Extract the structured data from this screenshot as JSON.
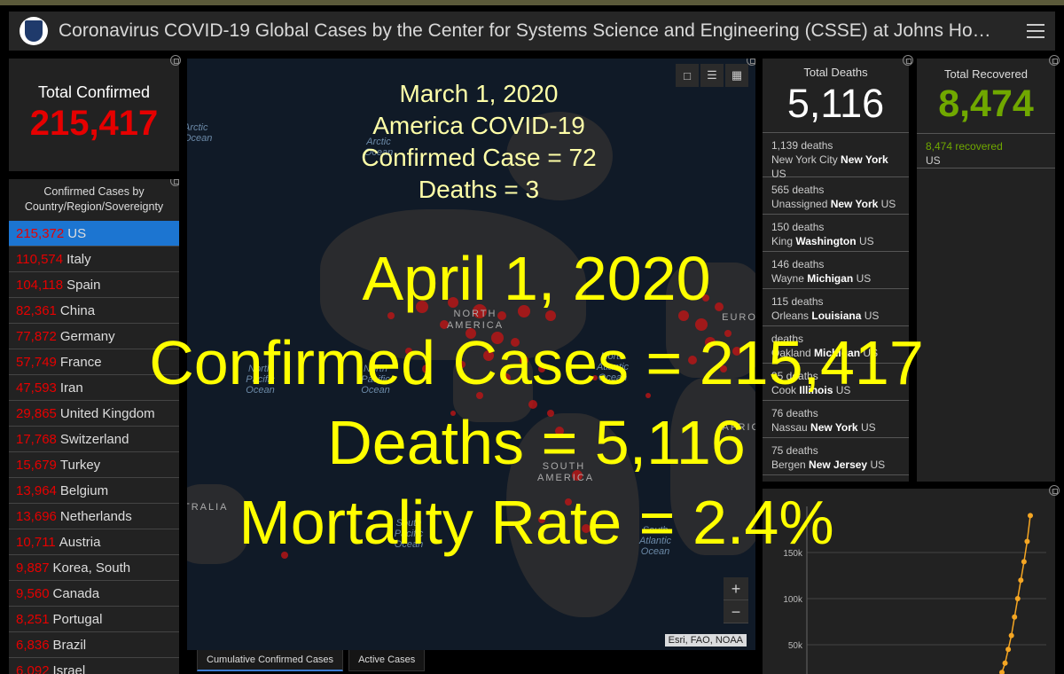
{
  "header": {
    "title": "Coronavirus COVID-19 Global Cases by the Center for Systems Science and Engineering (CSSE) at Johns Ho…"
  },
  "total_confirmed": {
    "label": "Total Confirmed",
    "value": "215,417"
  },
  "country_list": {
    "title": "Confirmed Cases by Country/Region/Sovereignty",
    "rows": [
      {
        "num": "215,372",
        "name": "US"
      },
      {
        "num": "110,574",
        "name": "Italy"
      },
      {
        "num": "104,118",
        "name": "Spain"
      },
      {
        "num": "82,361",
        "name": "China"
      },
      {
        "num": "77,872",
        "name": "Germany"
      },
      {
        "num": "57,749",
        "name": "France"
      },
      {
        "num": "47,593",
        "name": "Iran"
      },
      {
        "num": "29,865",
        "name": "United Kingdom"
      },
      {
        "num": "17,768",
        "name": "Switzerland"
      },
      {
        "num": "15,679",
        "name": "Turkey"
      },
      {
        "num": "13,964",
        "name": "Belgium"
      },
      {
        "num": "13,696",
        "name": "Netherlands"
      },
      {
        "num": "10,711",
        "name": "Austria"
      },
      {
        "num": "9,887",
        "name": "Korea, South"
      },
      {
        "num": "9,560",
        "name": "Canada"
      },
      {
        "num": "8,251",
        "name": "Portugal"
      },
      {
        "num": "6,836",
        "name": "Brazil"
      },
      {
        "num": "6,092",
        "name": "Israel"
      }
    ]
  },
  "map": {
    "labels": {
      "arctic_ocean": "Arctic Ocean",
      "arctic_left": "Arctic Ocean",
      "north_america": "NORTH AMERICA",
      "south_america": "SOUTH AMERICA",
      "north_pacific": "North Pacific Ocean",
      "north_atlantic": "North Atlantic Ocean",
      "south_pacific": "South Pacific Ocean",
      "south_atlantic": "South Atlantic Ocean",
      "europe": "EURO",
      "africa": "AFRIC",
      "australia": "TRALIA",
      "pacific_left": "North Pacific Ocean"
    },
    "attribution": "Esri, FAO, NOAA",
    "zoom_in": "+",
    "zoom_out": "−",
    "tabs": [
      "Cumulative Confirmed Cases",
      "Active Cases"
    ]
  },
  "total_deaths": {
    "label": "Total Deaths",
    "value": "5,116",
    "items": [
      {
        "count": "1,139 deaths",
        "place": "New York City",
        "state": "New York",
        "country": "US"
      },
      {
        "count": "565 deaths",
        "place": "Unassigned",
        "state": "New York",
        "country": "US"
      },
      {
        "count": "150 deaths",
        "place": "King",
        "state": "Washington",
        "country": "US"
      },
      {
        "count": "146 deaths",
        "place": "Wayne",
        "state": "Michigan",
        "country": "US"
      },
      {
        "count": "115 deaths",
        "place": "Orleans",
        "state": "Louisiana",
        "country": "US"
      },
      {
        "count": "deaths",
        "place": "Oakland",
        "state": "Michigan",
        "country": "US"
      },
      {
        "count": "95 deaths",
        "place": "Cook",
        "state": "Illinois",
        "country": "US"
      },
      {
        "count": "76 deaths",
        "place": "Nassau",
        "state": "New York",
        "country": "US"
      },
      {
        "count": "75 deaths",
        "place": "Bergen",
        "state": "New Jersey",
        "country": "US"
      }
    ]
  },
  "total_recovered": {
    "label": "Total Recovered",
    "value": "8,474",
    "item_count": "8,474",
    "item_suffix": "recovered",
    "item_country": "US"
  },
  "chart_data": {
    "type": "line",
    "title": "",
    "xlabel": "",
    "ylabel": "",
    "yticks": [
      "150k",
      "100k",
      "50k"
    ],
    "ylim": [
      0,
      200000
    ],
    "series": [
      {
        "color": "#f5a623",
        "values": [
          20000,
          30000,
          45000,
          60000,
          80000,
          100000,
          120000,
          140000,
          162000,
          190000
        ]
      }
    ]
  },
  "overlay": {
    "march_date": "March 1, 2020",
    "march_line2": "America COVID-19",
    "march_line3": "Confirmed Case = 72",
    "march_line4": "Deaths = 3",
    "april_date": "April 1, 2020",
    "april_confirmed": "Confirmed Cases = 215,417",
    "april_deaths": "Deaths = 5,116",
    "april_mortality": "Mortality Rate = 2.4%"
  }
}
